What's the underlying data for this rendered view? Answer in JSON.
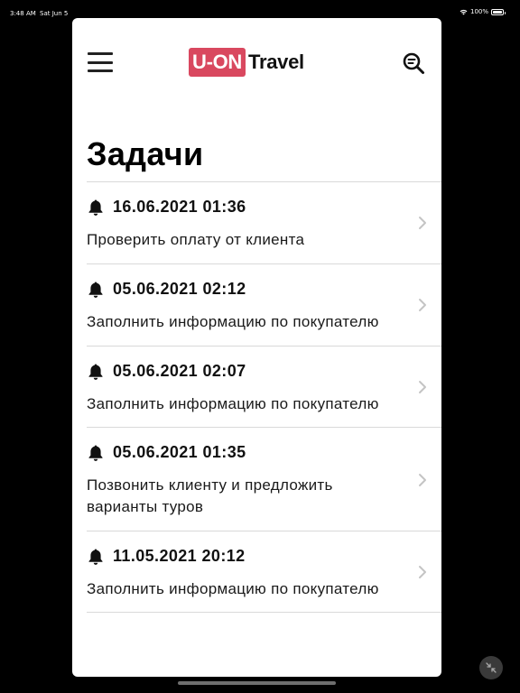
{
  "status_bar": {
    "time": "3:48 AM",
    "date": "Sat Jun 5",
    "battery": "100%"
  },
  "header": {
    "logo_badge": "U-ON",
    "logo_text": "Travel",
    "menu_icon": "hamburger-icon",
    "search_icon": "search-icon"
  },
  "page": {
    "title": "Задачи"
  },
  "tasks": [
    {
      "date": "16.06.2021 01:36",
      "text": "Проверить оплату от клиента"
    },
    {
      "date": "05.06.2021 02:12",
      "text": "Заполнить информацию по покупателю"
    },
    {
      "date": "05.06.2021 02:07",
      "text": "Заполнить информацию по покупателю"
    },
    {
      "date": "05.06.2021 01:35",
      "text": "Позвонить клиенту и предложить варианты туров"
    },
    {
      "date": "11.05.2021 20:12",
      "text": "Заполнить информацию по покупателю"
    }
  ],
  "colors": {
    "brand": "#d9485f",
    "background": "#000000",
    "sheet": "#ffffff"
  }
}
